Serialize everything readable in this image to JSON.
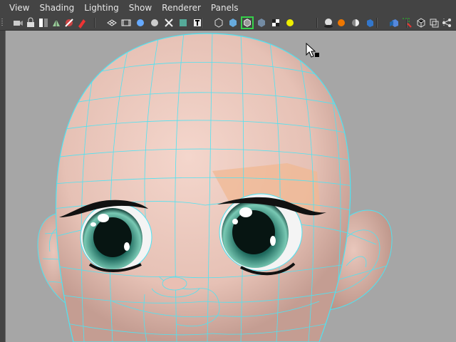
{
  "menu": {
    "items": [
      {
        "id": "view",
        "label": "View"
      },
      {
        "id": "shading",
        "label": "Shading"
      },
      {
        "id": "lighting",
        "label": "Lighting"
      },
      {
        "id": "show",
        "label": "Show"
      },
      {
        "id": "renderer",
        "label": "Renderer"
      },
      {
        "id": "panels",
        "label": "Panels"
      }
    ]
  },
  "toolbar": {
    "icons": [
      "select-camera-icon",
      "lock-camera-icon",
      "camera-attributes-icon",
      "bookmark-icon",
      "image-plane-icon",
      "2d-pan-zoom-icon",
      "grid-icon",
      "film-gate-icon",
      "resolution-gate-icon",
      "gate-mask-icon",
      "field-chart-icon",
      "safe-action-icon",
      "safe-title-icon",
      "wireframe-icon",
      "smooth-shade-icon",
      "wireframe-on-shaded-icon",
      "xray-icon",
      "textured-icon",
      "use-all-lights-icon",
      "shadows-icon",
      "screen-space-ao-icon",
      "motion-blur-icon",
      "anti-alias-icon",
      "depth-of-field-icon",
      "isolate-select-icon",
      "xray-joints-icon",
      "xray-active-components-icon",
      "share-icon"
    ],
    "selected": "wireframe-on-shaded-icon"
  },
  "viewport": {
    "content": "3d-head-model-wireframe",
    "colors": {
      "background": "#a6a6a6",
      "wireframe": "#4ee3f2",
      "skin": "#edc8bd",
      "iris": "#1f6a5e",
      "eyeliner": "#111111"
    }
  }
}
